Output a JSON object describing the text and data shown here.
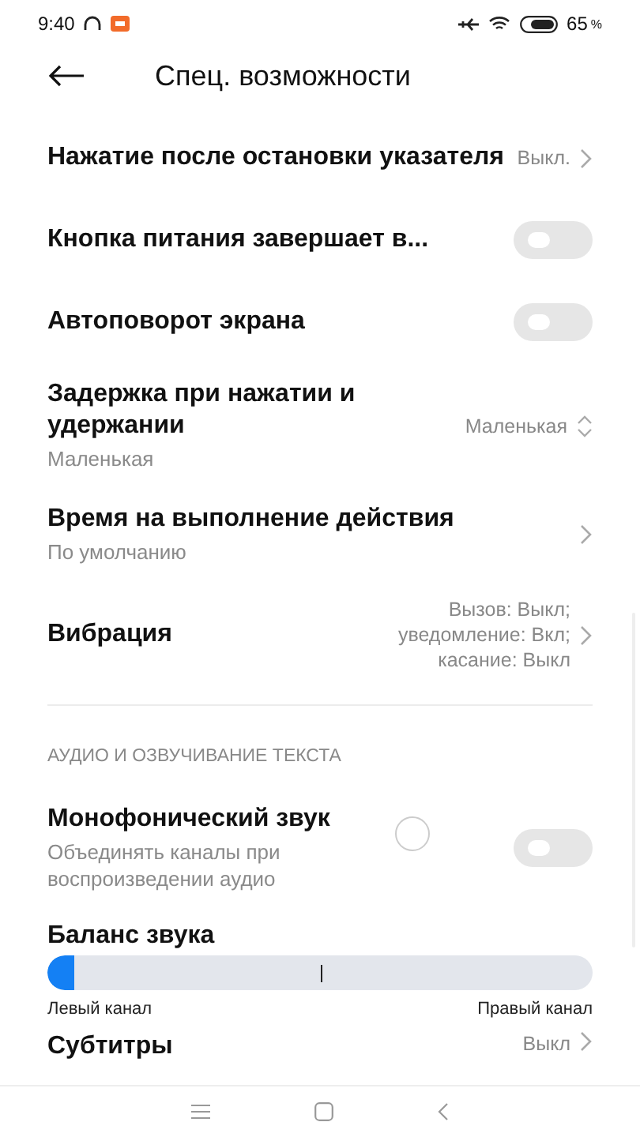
{
  "status_bar": {
    "time": "9:40",
    "battery": "65",
    "battery_unit": "%"
  },
  "header": {
    "title": "Спец. возможности"
  },
  "rows": [
    {
      "kind": "chevron",
      "title": "Нажатие после остановки указателя",
      "value": "Выкл."
    },
    {
      "kind": "toggle",
      "title": "Кнопка питания завершает в...",
      "on": false
    },
    {
      "kind": "toggle",
      "title": "Автоповорот экрана",
      "on": false
    },
    {
      "kind": "stepper",
      "title": "Задержка при нажатии и удержании",
      "subtitle": "Маленькая",
      "value": "Маленькая"
    },
    {
      "kind": "chevron",
      "title": "Время на выполнение действия",
      "subtitle": "По умолчанию"
    },
    {
      "kind": "chevron",
      "title": "Вибрация",
      "value": "Вызов: Выкл;\nуведомление: Вкл;\nкасание: Выкл"
    }
  ],
  "section": {
    "title": "АУДИО И ОЗВУЧИВАНИЕ ТЕКСТА",
    "rows": [
      {
        "kind": "toggle",
        "title": "Монофонический звук",
        "subtitle": "Объединять каналы при воспроизведении аудио",
        "on": false
      },
      {
        "kind": "slider",
        "title": "Баланс звука",
        "level": 0.05,
        "left_label": "Левый канал",
        "right_label": "Правый канал"
      },
      {
        "kind": "chevron",
        "title": "Субтитры",
        "value": "Выкл"
      }
    ]
  }
}
